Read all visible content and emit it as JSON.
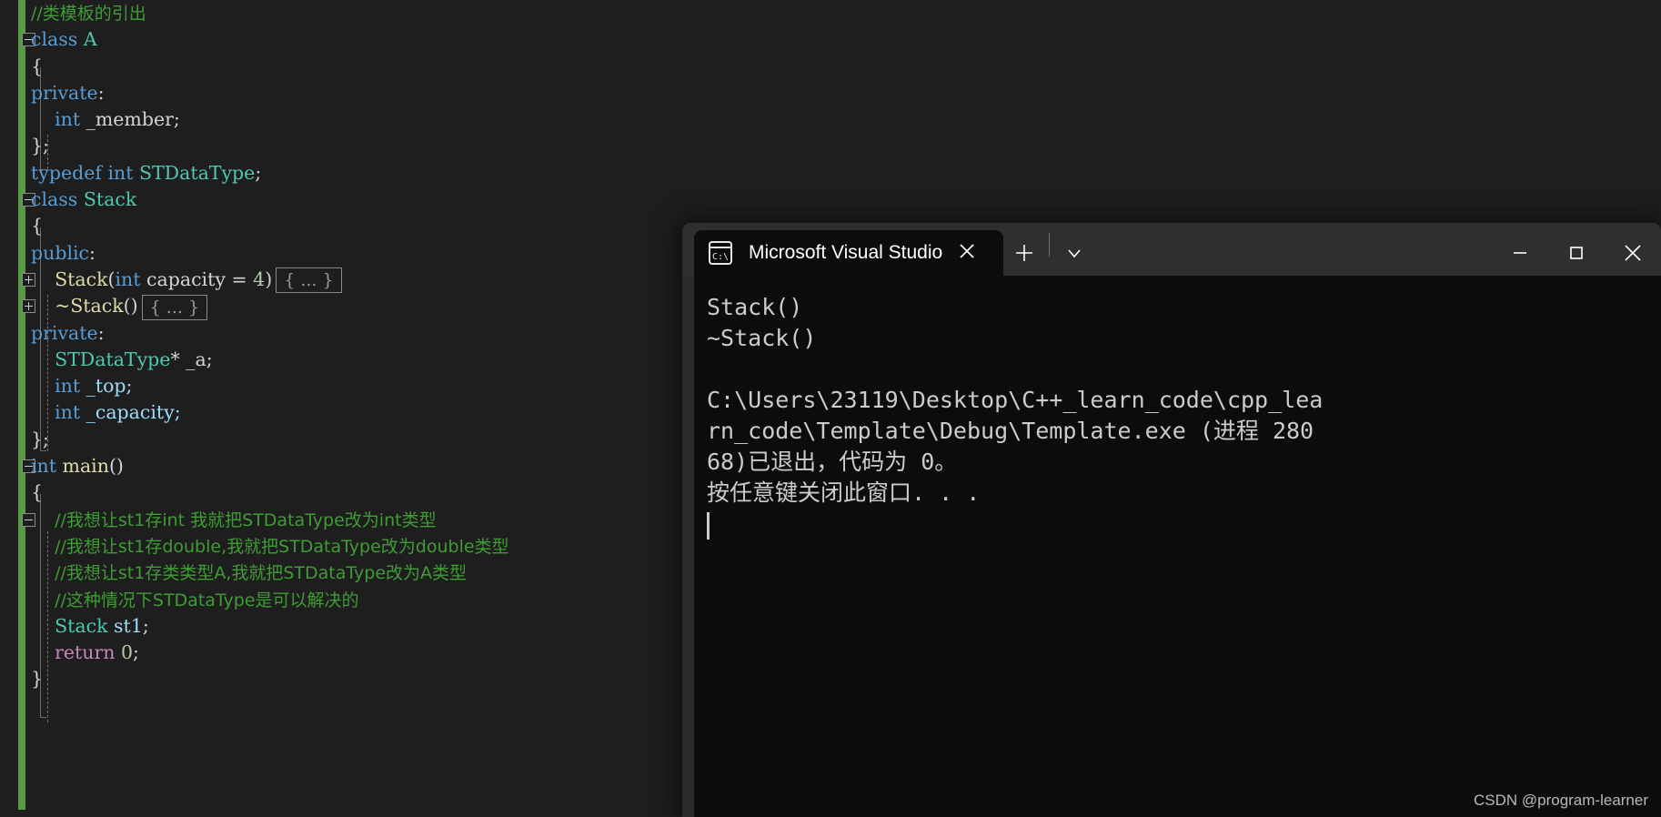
{
  "editor": {
    "lines": [
      {
        "indent": 0,
        "segments": [
          {
            "t": "//类模板的引出",
            "c": "cm"
          }
        ]
      },
      {
        "indent": 0,
        "fold": "minus",
        "segments": [
          {
            "t": "class ",
            "c": "kw"
          },
          {
            "t": "A",
            "c": "typ"
          }
        ]
      },
      {
        "indent": 0,
        "segments": [
          {
            "t": "{",
            "c": "punct"
          }
        ]
      },
      {
        "indent": 0,
        "segments": [
          {
            "t": "private",
            "c": "kw"
          },
          {
            "t": ":",
            "c": "punct"
          }
        ]
      },
      {
        "indent": 1,
        "segments": [
          {
            "t": "int",
            "c": "kw"
          },
          {
            "t": " _member;",
            "c": "pl"
          }
        ]
      },
      {
        "indent": 0,
        "segments": [
          {
            "t": "};",
            "c": "punct"
          }
        ]
      },
      {
        "indent": 0,
        "segments": [
          {
            "t": "typedef ",
            "c": "kw"
          },
          {
            "t": "int ",
            "c": "kw"
          },
          {
            "t": "STDataType",
            "c": "typ"
          },
          {
            "t": ";",
            "c": "punct"
          }
        ]
      },
      {
        "indent": 0,
        "fold": "minus",
        "segments": [
          {
            "t": "class ",
            "c": "kw"
          },
          {
            "t": "Stack",
            "c": "typ"
          }
        ]
      },
      {
        "indent": 0,
        "segments": [
          {
            "t": "{",
            "c": "punct"
          }
        ]
      },
      {
        "indent": 0,
        "segments": [
          {
            "t": "public",
            "c": "kw"
          },
          {
            "t": ":",
            "c": "punct"
          }
        ]
      },
      {
        "indent": 1,
        "fold": "plus",
        "collapsed": "{ ... }",
        "segments": [
          {
            "t": "Stack",
            "c": "fn"
          },
          {
            "t": "(",
            "c": "punct"
          },
          {
            "t": "int ",
            "c": "kw"
          },
          {
            "t": "capacity ",
            "c": "pl"
          },
          {
            "t": "= ",
            "c": "punct"
          },
          {
            "t": "4",
            "c": "num"
          },
          {
            "t": ")",
            "c": "punct"
          }
        ]
      },
      {
        "indent": 1,
        "fold": "plus",
        "collapsed": "{ ... }",
        "segments": [
          {
            "t": "~Stack",
            "c": "fn"
          },
          {
            "t": "()",
            "c": "punct"
          }
        ]
      },
      {
        "indent": 0,
        "segments": [
          {
            "t": "private",
            "c": "kw"
          },
          {
            "t": ":",
            "c": "punct"
          }
        ]
      },
      {
        "indent": 1,
        "segments": [
          {
            "t": "STDataType",
            "c": "typ"
          },
          {
            "t": "* ",
            "c": "punct"
          },
          {
            "t": "_a;",
            "c": "pl"
          }
        ]
      },
      {
        "indent": 1,
        "segments": [
          {
            "t": "int",
            "c": "kw"
          },
          {
            "t": " _top;",
            "c": "id"
          }
        ]
      },
      {
        "indent": 1,
        "segments": [
          {
            "t": "int",
            "c": "kw"
          },
          {
            "t": " _capacity;",
            "c": "id"
          }
        ]
      },
      {
        "indent": 0,
        "segments": [
          {
            "t": "};",
            "c": "punct"
          }
        ]
      },
      {
        "indent": 0,
        "fold": "minus",
        "segments": [
          {
            "t": "int ",
            "c": "kw"
          },
          {
            "t": "main",
            "c": "fn"
          },
          {
            "t": "()",
            "c": "punct"
          }
        ]
      },
      {
        "indent": 0,
        "segments": [
          {
            "t": "{",
            "c": "punct"
          }
        ]
      },
      {
        "indent": 1,
        "fold": "minus",
        "segments": [
          {
            "t": "//我想让st1存int 我就把STDataType改为int类型",
            "c": "cm"
          }
        ]
      },
      {
        "indent": 1,
        "segments": [
          {
            "t": "//我想让st1存double,我就把STDataType改为double类型",
            "c": "cm"
          }
        ]
      },
      {
        "indent": 1,
        "segments": [
          {
            "t": "//我想让st1存类类型A,我就把STDataType改为A类型",
            "c": "cm"
          }
        ]
      },
      {
        "indent": 1,
        "segments": [
          {
            "t": "//这种情况下STDataType是可以解决的",
            "c": "cm"
          }
        ]
      },
      {
        "indent": 1,
        "segments": [
          {
            "t": "Stack",
            "c": "typ"
          },
          {
            "t": " st1",
            "c": "id"
          },
          {
            "t": ";",
            "c": "punct"
          }
        ]
      },
      {
        "indent": 1,
        "segments": [
          {
            "t": "return ",
            "c": "ctl"
          },
          {
            "t": "0",
            "c": "num"
          },
          {
            "t": ";",
            "c": "punct"
          }
        ]
      },
      {
        "indent": 0,
        "segments": [
          {
            "t": "}",
            "c": "punct"
          }
        ]
      }
    ]
  },
  "terminal": {
    "tab": {
      "title": "Microsoft Visual Studio",
      "icon": "console-cmd-icon",
      "close_label": "✕"
    },
    "new_tab_label": "+",
    "dropdown_label": "˅",
    "window_controls": {
      "minimize": "minimize-icon",
      "maximize": "maximize-icon",
      "close": "close-icon"
    },
    "output": [
      "Stack()",
      "~Stack()",
      "",
      "C:\\Users\\23119\\Desktop\\C++_learn_code\\cpp_lea",
      "rn_code\\Template\\Debug\\Template.exe (进程 280",
      "68)已退出，代码为 0。",
      "按任意键关闭此窗口. . ."
    ]
  },
  "watermark": "CSDN @program-learner",
  "colors": {
    "editor_bg": "#1e1e1e",
    "console_bg": "#0c0c0c",
    "titlebar_bg": "#2f2f2f",
    "change_marker": "#579c45",
    "comment": "#3f9c35",
    "keyword": "#569cd6",
    "type": "#4ec9b0",
    "function": "#dcdcaa"
  }
}
